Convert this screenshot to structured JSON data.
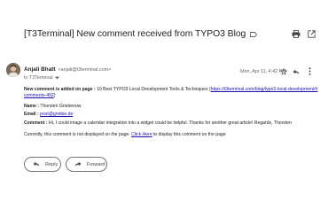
{
  "email": {
    "subject": "[T3Terminal] New comment received from TYPO3 Blog",
    "sender_name": "Anjali Bhatt",
    "sender_email": "<anjali@t3terminal.com>",
    "to": "to T3Terminal",
    "date": "Mon, Apr 11, 4:42 PM"
  },
  "body": {
    "line1_label": "New comment is added on page :",
    "line1_text": "10 Best TYPO3 Local Development Tools & Techniques (",
    "line1_link": "https://t3terminal.com/blog/typo3-local-development/#",
    "line1_link_cont": "comments-492",
    "line1_close": ")",
    "name_label": "Name :",
    "name_value": "Thorsten Griebenow",
    "email_label": "Email :",
    "email_value": "post@griebie.de",
    "comment_label": "Comment :",
    "comment_value": "Hi, I could image a calendar integration into a widget could be helpful. Thanks for another great article! Regards, Thorsten",
    "status_pre": "Currently, this comment is not displayed on the page.",
    "status_link": "Click Here",
    "status_post": "to display this comment on the page"
  },
  "actions": {
    "reply": "Reply",
    "forward": "Forward"
  }
}
